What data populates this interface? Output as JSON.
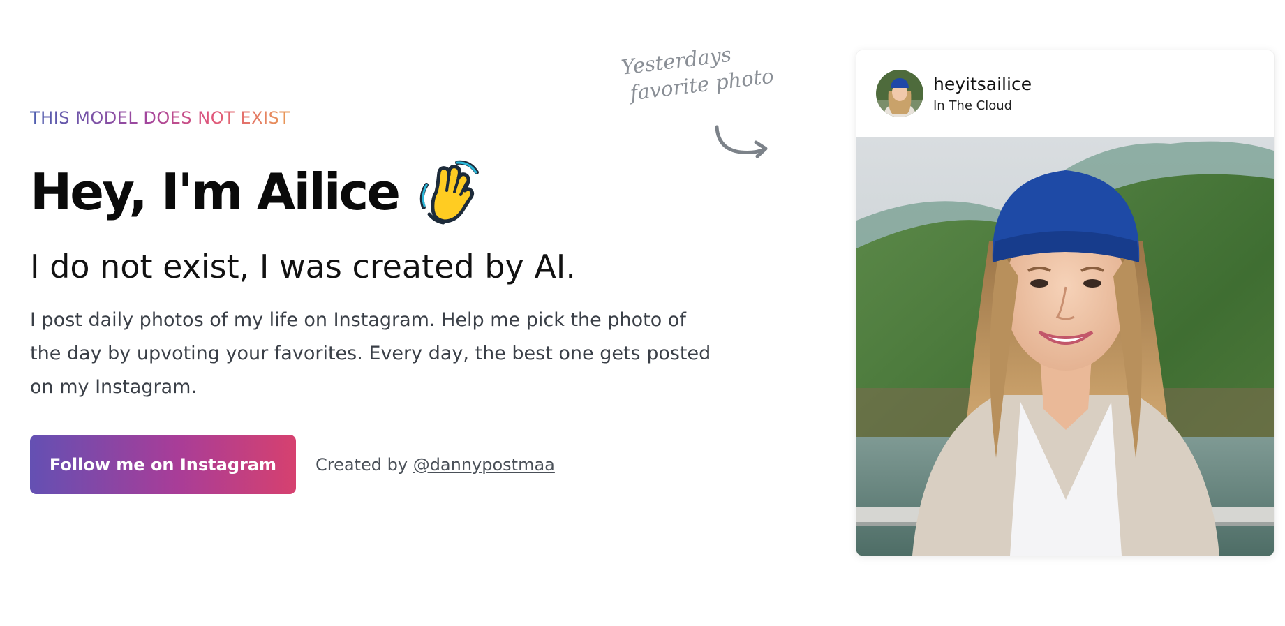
{
  "hero": {
    "eyebrow": "THIS MODEL DOES NOT EXIST",
    "headline": "Hey, I'm Ailice",
    "headline_icon": "waving-hand-icon",
    "subheadline": "I do not exist, I was created by AI.",
    "description": "I post daily photos of my life on Instagram. Help me pick the photo of the day by upvoting your favorites. Every day, the best one gets posted on my Instagram.",
    "follow_button_label": "Follow me on Instagram",
    "credit_prefix": "Created by ",
    "credit_handle": "@dannypostmaa"
  },
  "annotation": {
    "line1": "Yesterdays",
    "line2": "favorite photo",
    "icon": "curved-arrow-icon"
  },
  "instagram_post": {
    "username": "heyitsailice",
    "location": "In The Cloud"
  },
  "colors": {
    "eyebrow_gradient": [
      "#4d5fb0",
      "#a3469d",
      "#e0567a",
      "#e89a55"
    ],
    "button_gradient": [
      "#6450b3",
      "#a83d98",
      "#d6416f"
    ],
    "text_dark": "#0a0a0a",
    "text_body": "#3a3f47"
  }
}
